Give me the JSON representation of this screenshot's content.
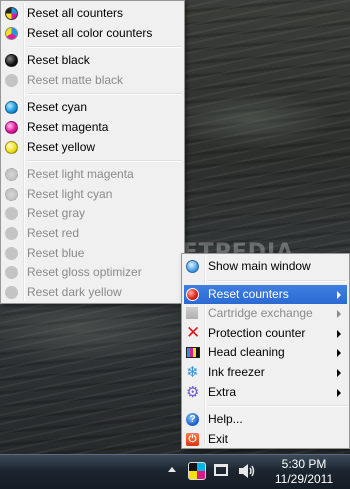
{
  "watermark": "SOFTPEDIA",
  "colors": {
    "menu_bg": "#f0f0f0",
    "selection": "#3173db",
    "cyan": "#1a9be0",
    "magenta": "#e2199f",
    "yellow": "#f2e21a",
    "black": "#111111",
    "disabled": "#8a8a8a"
  },
  "counters_menu": {
    "items": [
      {
        "label": "Reset all counters",
        "icon": "ink-all-icon",
        "enabled": true
      },
      {
        "label": "Reset all color counters",
        "icon": "ink-color-icon",
        "enabled": true
      },
      {
        "label": "Reset black",
        "icon": "black-ink-icon",
        "enabled": true
      },
      {
        "label": "Reset matte black",
        "icon": "matte-black-ink-icon",
        "enabled": false
      },
      {
        "label": "Reset cyan",
        "icon": "cyan-ink-icon",
        "enabled": true
      },
      {
        "label": "Reset magenta",
        "icon": "magenta-ink-icon",
        "enabled": true
      },
      {
        "label": "Reset yellow",
        "icon": "yellow-ink-icon",
        "enabled": true
      },
      {
        "label": "Reset light magenta",
        "icon": "light-magenta-ink-icon",
        "enabled": false
      },
      {
        "label": "Reset light cyan",
        "icon": "light-cyan-ink-icon",
        "enabled": false
      },
      {
        "label": "Reset gray",
        "icon": "gray-ink-icon",
        "enabled": false
      },
      {
        "label": "Reset red",
        "icon": "red-ink-icon",
        "enabled": false
      },
      {
        "label": "Reset blue",
        "icon": "blue-ink-icon",
        "enabled": false
      },
      {
        "label": "Reset gloss optimizer",
        "icon": "gloss-optimizer-icon",
        "enabled": false
      },
      {
        "label": "Reset dark yellow",
        "icon": "dark-yellow-ink-icon",
        "enabled": false
      }
    ]
  },
  "main_menu": {
    "items": [
      {
        "label": "Show main window",
        "icon": "show-window-icon",
        "enabled": true
      },
      {
        "label": "Reset counters",
        "icon": "reset-counters-icon",
        "enabled": true,
        "submenu": true,
        "selected": true
      },
      {
        "label": "Cartridge exchange",
        "icon": "cartridge-exchange-icon",
        "enabled": false,
        "submenu": true
      },
      {
        "label": "Protection counter",
        "icon": "protection-counter-icon",
        "enabled": true,
        "submenu": true
      },
      {
        "label": "Head cleaning",
        "icon": "head-cleaning-icon",
        "enabled": true,
        "submenu": true
      },
      {
        "label": "Ink freezer",
        "icon": "ink-freezer-icon",
        "enabled": true,
        "submenu": true
      },
      {
        "label": "Extra",
        "icon": "extra-gear-icon",
        "enabled": true,
        "submenu": true
      },
      {
        "label": "Help...",
        "icon": "help-icon",
        "enabled": true
      },
      {
        "label": "Exit",
        "icon": "exit-icon",
        "enabled": true
      }
    ]
  },
  "taskbar": {
    "time": "5:30 PM",
    "date": "11/29/2011"
  }
}
